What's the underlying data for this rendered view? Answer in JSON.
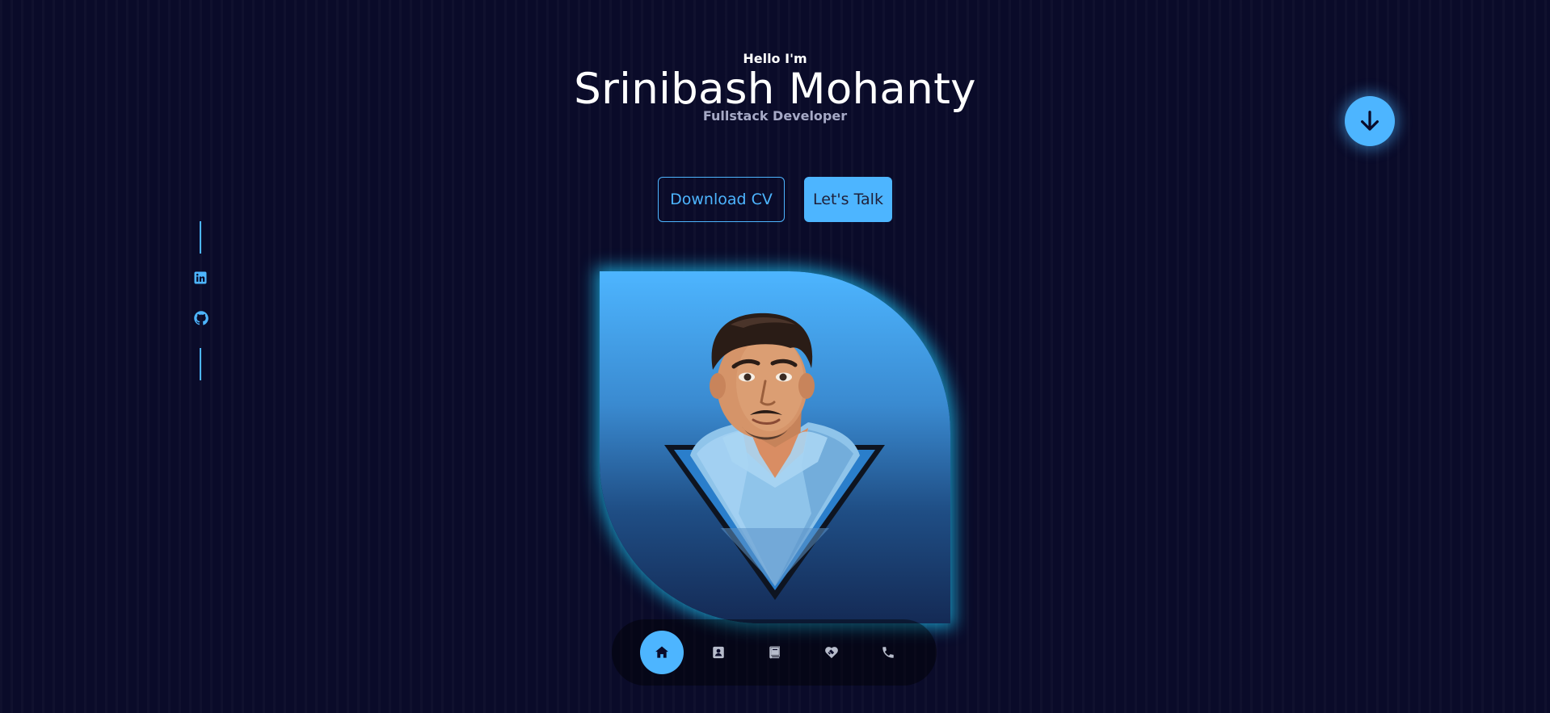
{
  "hero": {
    "greeting": "Hello I'm",
    "name": "Srinibash Mohanty",
    "role": "Fullstack Developer"
  },
  "cta": {
    "download_label": "Download CV",
    "talk_label": "Let's Talk"
  },
  "scroll_button": {
    "icon": "arrow-down-icon"
  },
  "socials": [
    {
      "network": "LinkedIn",
      "icon": "linkedin-icon"
    },
    {
      "network": "GitHub",
      "icon": "github-icon"
    }
  ],
  "bottom_nav": [
    {
      "section": "home",
      "icon": "home-icon",
      "active": true
    },
    {
      "section": "about",
      "icon": "contact-card-icon",
      "active": false
    },
    {
      "section": "experience",
      "icon": "book-icon",
      "active": false
    },
    {
      "section": "services",
      "icon": "handshake-icon",
      "active": false
    },
    {
      "section": "contact",
      "icon": "phone-icon",
      "active": false
    }
  ],
  "colors": {
    "background": "#0a0b29",
    "primary": "#4db5ff",
    "glow": "#20ceff",
    "text": "#ffffff",
    "text_muted": "#a6a9c6",
    "nav_icon_inactive": "#b7bccb"
  }
}
